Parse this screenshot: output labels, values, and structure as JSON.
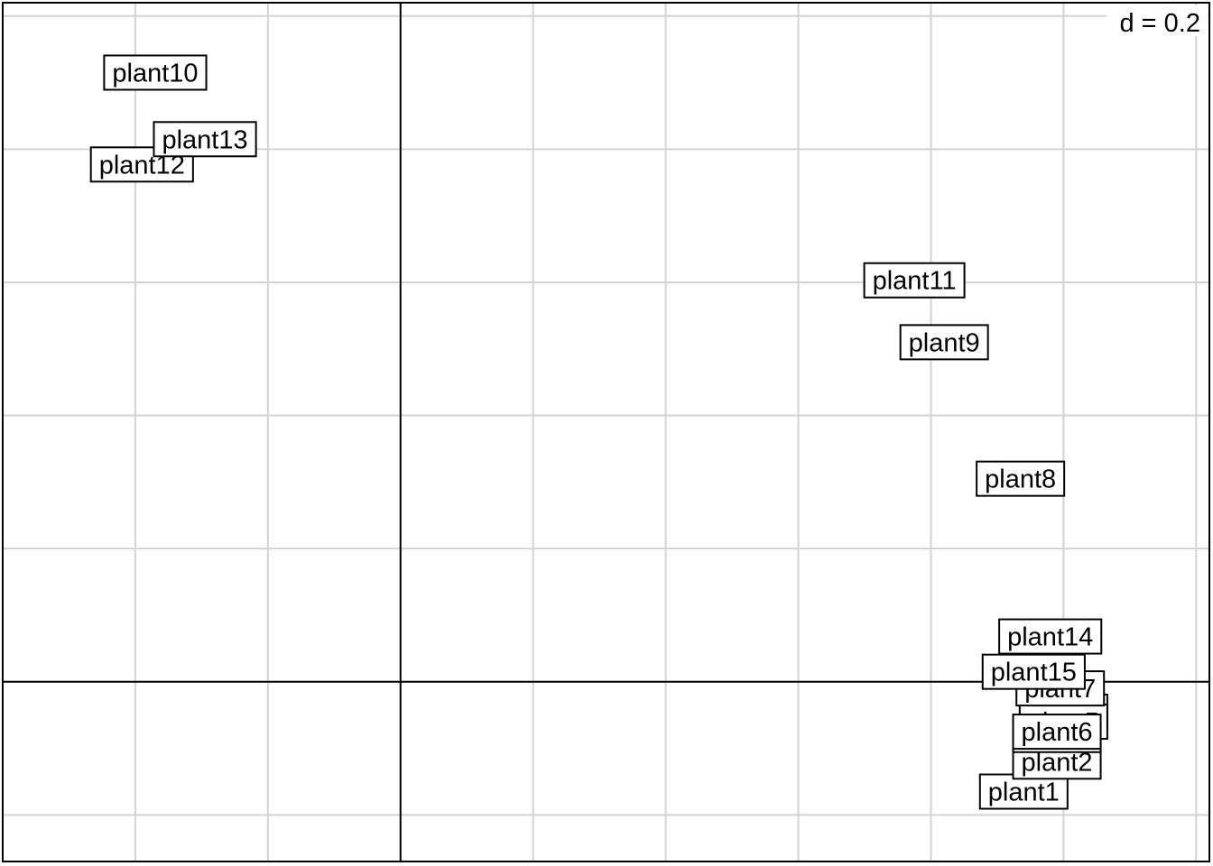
{
  "chart_data": {
    "type": "scatter",
    "scale_label": "d = 0.2",
    "grid": true,
    "grid_step": 0.2,
    "xlim": [
      -0.6,
      1.22
    ],
    "ylim": [
      -0.27,
      1.02
    ],
    "colors": {
      "grid": "#d3d3d3",
      "axes": "#000000",
      "frame": "#000000",
      "label_border": "#000000",
      "label_fill": "#ffffff"
    },
    "points": [
      {
        "label": "plant1",
        "x": 0.94,
        "y": -0.165
      },
      {
        "label": "plant2",
        "x": 0.99,
        "y": -0.12
      },
      {
        "label": "plant3",
        "x": 0.99,
        "y": -0.08
      },
      {
        "label": "plant4",
        "x": 1.0,
        "y": -0.045
      },
      {
        "label": "plant5",
        "x": 1.0,
        "y": -0.06
      },
      {
        "label": "plant6",
        "x": 0.99,
        "y": -0.075
      },
      {
        "label": "plant7",
        "x": 0.995,
        "y": -0.01
      },
      {
        "label": "plant8",
        "x": 0.935,
        "y": 0.305
      },
      {
        "label": "plant9",
        "x": 0.82,
        "y": 0.51
      },
      {
        "label": "plant10",
        "x": -0.37,
        "y": 0.915
      },
      {
        "label": "plant11",
        "x": 0.775,
        "y": 0.603
      },
      {
        "label": "plant12",
        "x": -0.39,
        "y": 0.777
      },
      {
        "label": "plant13",
        "x": -0.295,
        "y": 0.815
      },
      {
        "label": "plant14",
        "x": 0.98,
        "y": 0.068
      },
      {
        "label": "plant15",
        "x": 0.955,
        "y": 0.015
      }
    ]
  }
}
